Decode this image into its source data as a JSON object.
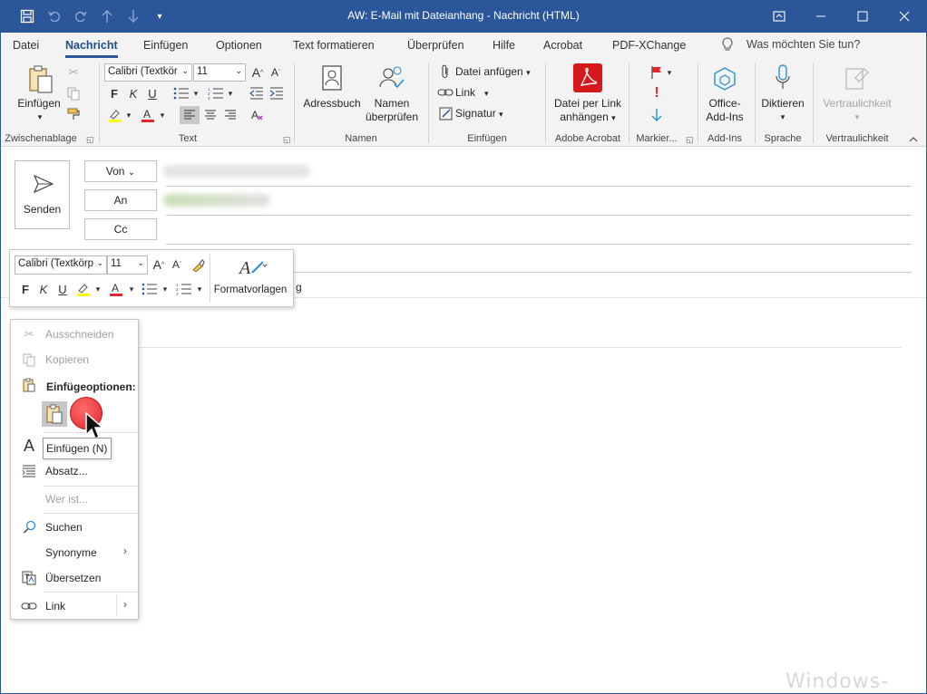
{
  "window": {
    "title": "AW: E-Mail mit Dateianhang  -  Nachricht (HTML)",
    "accent": "#2b579a"
  },
  "quick_access": [
    "save-icon",
    "undo-icon",
    "redo-icon",
    "up-icon",
    "down-icon",
    "customize-icon"
  ],
  "tabs": [
    {
      "label": "Datei"
    },
    {
      "label": "Nachricht",
      "active": true
    },
    {
      "label": "Einfügen"
    },
    {
      "label": "Optionen"
    },
    {
      "label": "Text formatieren"
    },
    {
      "label": "Überprüfen"
    },
    {
      "label": "Hilfe"
    },
    {
      "label": "Acrobat"
    },
    {
      "label": "PDF-XChange"
    }
  ],
  "tell_me": "Was möchten Sie tun?",
  "ribbon": {
    "clipboard": {
      "paste": "Einfügen",
      "group": "Zwischenablage"
    },
    "text": {
      "font": "Calibri (Textkör",
      "size": "11",
      "group": "Text"
    },
    "names": {
      "addressbook": "Adressbuch",
      "check_names_1": "Namen",
      "check_names_2": "überprüfen",
      "group": "Namen"
    },
    "insert": {
      "attach": "Datei anfügen",
      "link": "Link",
      "signature": "Signatur",
      "group": "Einfügen"
    },
    "acrobat": {
      "line1": "Datei per Link",
      "line2": "anhängen",
      "group": "Adobe Acrobat"
    },
    "tags": {
      "group": "Markier..."
    },
    "addins": {
      "line1": "Office-",
      "line2": "Add-Ins",
      "group": "Add-Ins"
    },
    "voice": {
      "dictate": "Diktieren",
      "group": "Sprache"
    },
    "sensitivity": {
      "label": "Vertraulichkeit",
      "group": "Vertraulichkeit"
    }
  },
  "compose": {
    "send": "Senden",
    "from": "Von",
    "to": "An",
    "cc": "Cc",
    "subject_tail": "g"
  },
  "mini_toolbar": {
    "font": "Calibri (Textkörp",
    "size": "11",
    "styles": "Formatvorlagen"
  },
  "context_menu": {
    "cut": "Ausschneiden",
    "copy": "Kopieren",
    "paste_options": "Einfügeoptionen:",
    "paragraph": "Absatz...",
    "who_is": "Wer ist...",
    "search": "Suchen",
    "synonyms": "Synonyme",
    "translate": "Übersetzen",
    "link": "Link"
  },
  "tooltip": "Einfügen (N)",
  "watermark": "Windows-FAQ"
}
